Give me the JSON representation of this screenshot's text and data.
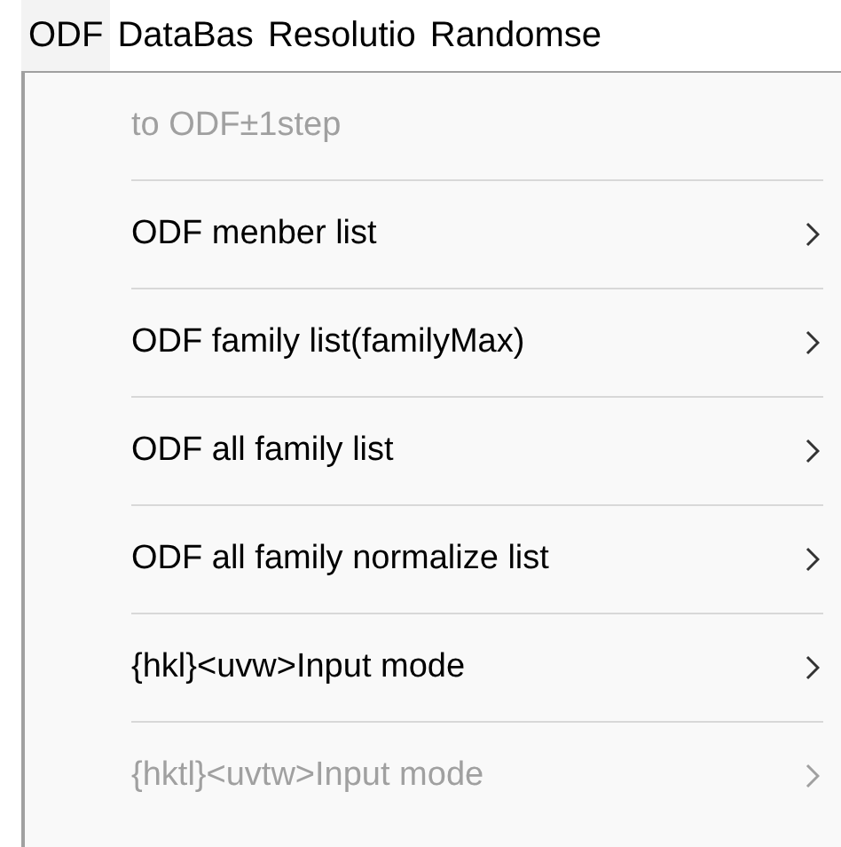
{
  "menu_bar": [
    {
      "label": "ODF",
      "selected": true
    },
    {
      "label": "DataBas",
      "selected": false
    },
    {
      "label": "Resolutio",
      "selected": false
    },
    {
      "label": "Randomse",
      "selected": false
    }
  ],
  "menu": {
    "items": [
      {
        "label": "to ODF±1step",
        "disabled": true,
        "submenu": false
      },
      {
        "label": "ODF menber list",
        "disabled": false,
        "submenu": true
      },
      {
        "label": "ODF family list(familyMax)",
        "disabled": false,
        "submenu": true
      },
      {
        "label": "ODF all family list",
        "disabled": false,
        "submenu": true
      },
      {
        "label": "ODF all family normalize list",
        "disabled": false,
        "submenu": true
      },
      {
        "label": "{hkl}<uvw>Input mode",
        "disabled": false,
        "submenu": true
      },
      {
        "label": "{hktl}<uvtw>Input mode",
        "disabled": true,
        "submenu": true
      }
    ]
  }
}
